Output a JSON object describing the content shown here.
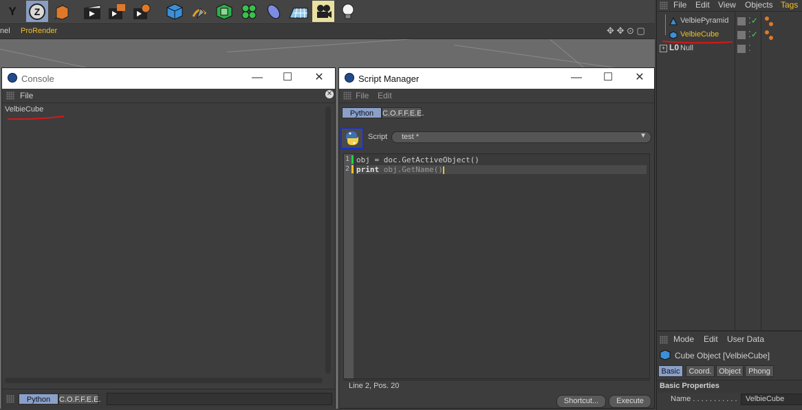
{
  "toolbar": {
    "items": [
      "y-axis-lock",
      "z-axis-lock",
      "world-coordinates",
      "render-view",
      "render-picture-viewer",
      "render-settings",
      "cube-primitive",
      "pen-spline",
      "subdivision-surface",
      "mograph-cloner",
      "deformer",
      "floor-environment",
      "camera",
      "light"
    ],
    "y_label": "Y",
    "z_label": "Z"
  },
  "menu_strip": {
    "panel_label": "nel",
    "prorender_label": "ProRender"
  },
  "console": {
    "title": "Console",
    "menu_file": "File",
    "output_text": "VelbieCube",
    "tab_python": "Python",
    "tab_coffee": "C.O.F.F.E.E."
  },
  "script_manager": {
    "title": "Script Manager",
    "menu_file": "File",
    "menu_edit": "Edit",
    "tab_python": "Python",
    "tab_coffee": "C.O.F.F.E.E.",
    "script_label": "Script",
    "script_selected": "test *",
    "code": [
      {
        "num": "1",
        "text": "obj = doc.GetActiveObject()"
      },
      {
        "num": "2",
        "kw": "print",
        "text": " obj.GetName()"
      }
    ],
    "status": "Line 2, Pos. 20",
    "shortcut_button": "Shortcut...",
    "execute_button": "Execute"
  },
  "object_manager": {
    "menu": [
      "File",
      "Edit",
      "View",
      "Objects",
      "Tags"
    ],
    "objects": [
      {
        "name": "VelbiePyramid",
        "selected": false
      },
      {
        "name": "VelbieCube",
        "selected": true
      },
      {
        "name": "Null",
        "selected": false
      }
    ]
  },
  "attribute_manager": {
    "menu": [
      "Mode",
      "Edit",
      "User Data"
    ],
    "object_title": "Cube Object [VelbieCube]",
    "tabs": [
      "Basic",
      "Coord.",
      "Object",
      "Phong"
    ],
    "section": "Basic Properties",
    "name_label": "Name . . . . . . . . . . .",
    "name_value": "VelbieCube"
  },
  "colors": {
    "selected_text": "#f0c030",
    "tab_active": "#8aa0c8",
    "annotation": "#d81818"
  }
}
